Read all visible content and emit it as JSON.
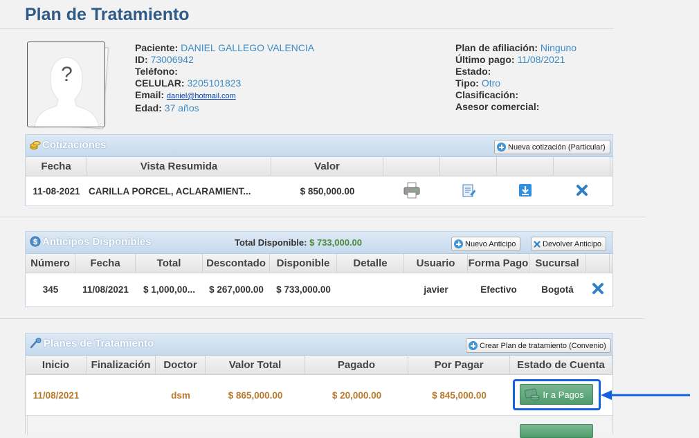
{
  "page": {
    "title": "Plan de Tratamiento"
  },
  "patient": {
    "photo_placeholder": "?",
    "left": [
      {
        "label": "Paciente:",
        "value": "DANIEL GALLEGO VALENCIA"
      },
      {
        "label": "ID:",
        "value": "73006942"
      },
      {
        "label": "Teléfono:",
        "value": ""
      },
      {
        "label": "CELULAR:",
        "value": "3205101823"
      },
      {
        "label": "Email:",
        "value": "daniel@hotmail.com"
      },
      {
        "label": "Edad:",
        "value": "37 años"
      }
    ],
    "right": [
      {
        "label": "Plan de afiliación:",
        "value": "Ninguno"
      },
      {
        "label": "Último pago:",
        "value": "11/08/2021"
      },
      {
        "label": "Estado:",
        "value": ""
      },
      {
        "label": "Tipo:",
        "value": "Otro"
      },
      {
        "label": "Clasificación:",
        "value": ""
      },
      {
        "label": "Asesor comercial:",
        "value": ""
      }
    ]
  },
  "cotizaciones": {
    "title": "Cotizaciones",
    "new_button": "Nueva cotización (Particular)",
    "headers": [
      "Fecha",
      "Vista Resumida",
      "Valor",
      "",
      "",
      "",
      ""
    ],
    "rows": [
      {
        "fecha": "11-08-2021",
        "vista": "CARILLA PORCEL, ACLARAMIENT...",
        "valor": "$ 850,000.00"
      }
    ]
  },
  "anticipos": {
    "title": "Anticipos Disponibles",
    "total_label": "Total Disponible:",
    "total_value": "$ 733,000.00",
    "new_button": "Nuevo Anticipo",
    "return_button": "Devolver Anticipo",
    "headers": [
      "Número",
      "Fecha",
      "Total",
      "Descontado",
      "Disponible",
      "Detalle",
      "Usuario",
      "Forma Pago",
      "Sucursal",
      ""
    ],
    "rows": [
      {
        "numero": "345",
        "fecha": "11/08/2021",
        "total": "$ 1,000,00...",
        "descontado": "$ 267,000.00",
        "disponible": "$ 733,000.00",
        "detalle": "",
        "usuario": "javier",
        "forma_pago": "Efectivo",
        "sucursal": "Bogotá"
      }
    ]
  },
  "planes": {
    "title": "Planes de Tratamiento",
    "new_button": "Crear Plan de tratamiento (Convenio)",
    "headers": [
      "Inicio",
      "Finalización",
      "Doctor",
      "Valor Total",
      "Pagado",
      "Por Pagar",
      "Estado de Cuenta"
    ],
    "rows": [
      {
        "inicio": "11/08/2021",
        "finalizacion": "",
        "doctor": "dsm",
        "valor_total": "$ 865,000.00",
        "pagado": "$ 20,000.00",
        "por_pagar": "$ 845,000.00",
        "action": "Ir a Pagos"
      }
    ]
  },
  "colors": {
    "title_blue": "#2f5b86",
    "value_blue": "#3d8bc4",
    "total_green": "#4e8a3e",
    "row_orange": "#b8792b",
    "pay_green": "#5fa67a",
    "highlight_blue": "#1560e0",
    "delete_blue": "#2f7fc7"
  },
  "icons": {
    "cotizaciones": "coins-icon",
    "anticipos": "dollar-circle-icon",
    "planes": "tooth-tool-icon",
    "print": "printer-icon",
    "edit": "edit-document-icon",
    "download": "download-icon",
    "delete": "delete-x-icon",
    "money": "money-icon",
    "annotation": "arrow-left-icon"
  }
}
